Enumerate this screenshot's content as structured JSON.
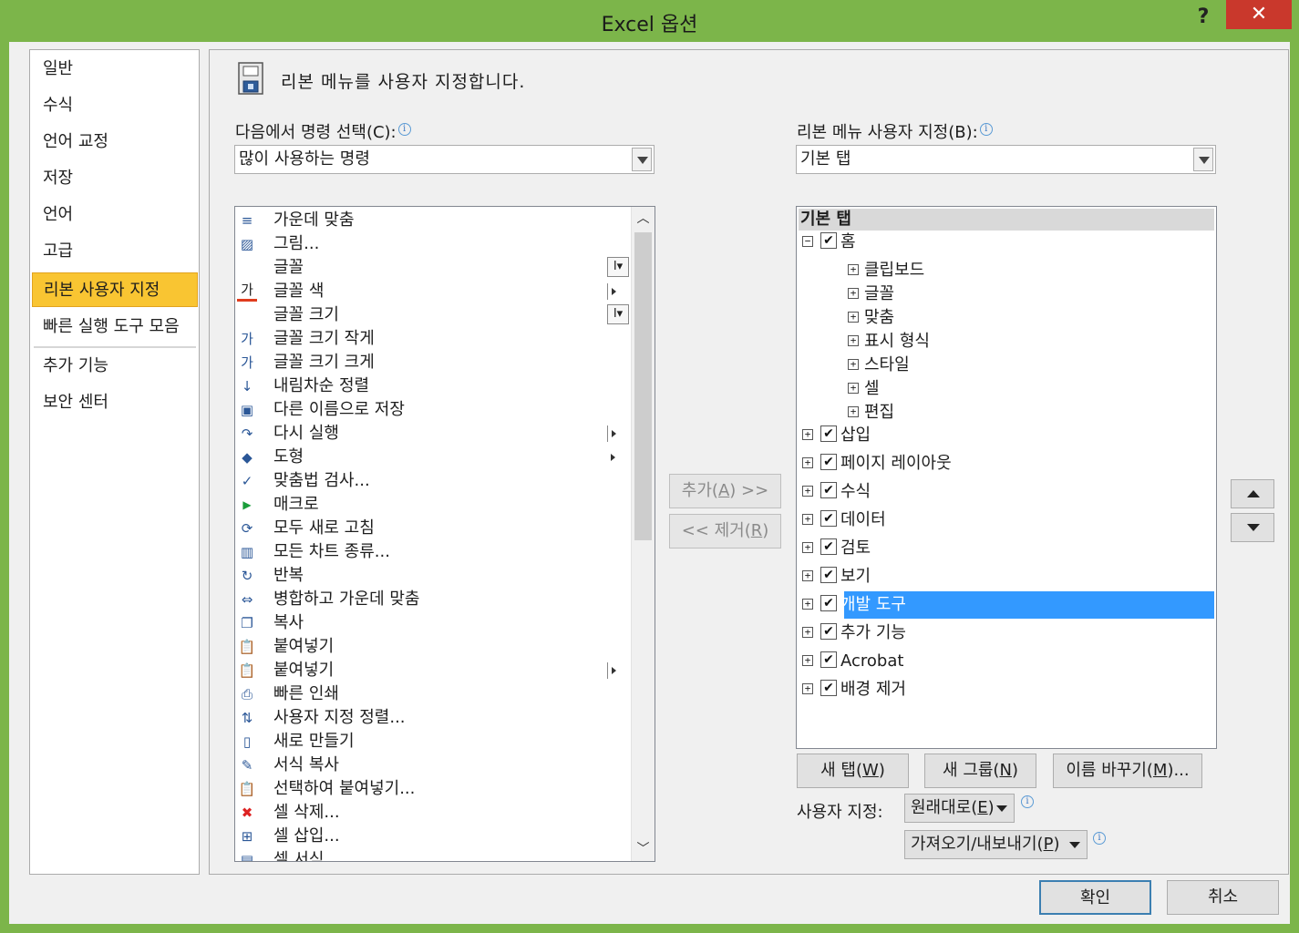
{
  "window": {
    "title": "Excel 옵션",
    "help": "?",
    "close": "✕"
  },
  "nav": {
    "items": [
      {
        "label": "일반",
        "active": false
      },
      {
        "label": "수식",
        "active": false
      },
      {
        "label": "언어 교정",
        "active": false
      },
      {
        "label": "저장",
        "active": false
      },
      {
        "label": "언어",
        "active": false
      },
      {
        "label": "고급",
        "active": false
      },
      {
        "label": "리본 사용자 지정",
        "active": true
      },
      {
        "label": "빠른 실행 도구 모음",
        "active": false
      },
      {
        "label": "추가 기능",
        "active": false
      },
      {
        "label": "보안 센터",
        "active": false
      }
    ]
  },
  "main": {
    "heading": "리본 메뉴를 사용자 지정합니다.",
    "left_label": "다음에서 명령 선택",
    "left_label_key": "(C):",
    "left_combo": "많이 사용하는 명령",
    "right_label": "리본 메뉴 사용자 지정",
    "right_label_key": "(B):",
    "right_combo": "기본 탭",
    "info_glyph": "i"
  },
  "commands": [
    {
      "label": "가운데 맞춤",
      "icon": "align-center-icon",
      "glyph": "≡",
      "extra": ""
    },
    {
      "label": "그림...",
      "icon": "picture-icon",
      "glyph": "▨",
      "extra": ""
    },
    {
      "label": "글꼴",
      "icon": "",
      "glyph": "",
      "extra": "font-control"
    },
    {
      "label": "글꼴 색",
      "icon": "font-color-icon",
      "glyph": "가",
      "extra": "submenu"
    },
    {
      "label": "글꼴 크기",
      "icon": "",
      "glyph": "",
      "extra": "font-control"
    },
    {
      "label": "글꼴 크기 작게",
      "icon": "shrink-font-icon",
      "glyph": "가",
      "extra": ""
    },
    {
      "label": "글꼴 크기 크게",
      "icon": "grow-font-icon",
      "glyph": "가",
      "extra": ""
    },
    {
      "label": "내림차순 정렬",
      "icon": "sort-descending-icon",
      "glyph": "↓",
      "extra": ""
    },
    {
      "label": "다른 이름으로 저장",
      "icon": "save-as-icon",
      "glyph": "▣",
      "extra": ""
    },
    {
      "label": "다시 실행",
      "icon": "redo-icon",
      "glyph": "↷",
      "extra": "submenu"
    },
    {
      "label": "도형",
      "icon": "shapes-icon",
      "glyph": "◆",
      "extra": "submenu-noline"
    },
    {
      "label": "맞춤법 검사...",
      "icon": "spelling-icon",
      "glyph": "✓",
      "extra": ""
    },
    {
      "label": "매크로",
      "icon": "macro-icon",
      "glyph": "▶",
      "extra": ""
    },
    {
      "label": "모두 새로 고침",
      "icon": "refresh-all-icon",
      "glyph": "⟳",
      "extra": ""
    },
    {
      "label": "모든 차트 종류...",
      "icon": "chart-icon",
      "glyph": "▥",
      "extra": ""
    },
    {
      "label": "반복",
      "icon": "repeat-icon",
      "glyph": "↻",
      "extra": ""
    },
    {
      "label": "병합하고 가운데 맞춤",
      "icon": "merge-center-icon",
      "glyph": "⇔",
      "extra": ""
    },
    {
      "label": "복사",
      "icon": "copy-icon",
      "glyph": "❐",
      "extra": ""
    },
    {
      "label": "붙여넣기",
      "icon": "paste-icon",
      "glyph": "📋",
      "extra": ""
    },
    {
      "label": "붙여넣기",
      "icon": "paste-icon",
      "glyph": "📋",
      "extra": "submenu"
    },
    {
      "label": "빠른 인쇄",
      "icon": "quick-print-icon",
      "glyph": "⎙",
      "extra": ""
    },
    {
      "label": "사용자 지정 정렬...",
      "icon": "custom-sort-icon",
      "glyph": "⇅",
      "extra": ""
    },
    {
      "label": "새로 만들기",
      "icon": "new-file-icon",
      "glyph": "▯",
      "extra": ""
    },
    {
      "label": "서식 복사",
      "icon": "format-painter-icon",
      "glyph": "✎",
      "extra": ""
    },
    {
      "label": "선택하여 붙여넣기...",
      "icon": "paste-special-icon",
      "glyph": "📋",
      "extra": ""
    },
    {
      "label": "셀 삭제...",
      "icon": "delete-cells-icon",
      "glyph": "✖",
      "extra": ""
    },
    {
      "label": "셀 삽입...",
      "icon": "insert-cells-icon",
      "glyph": "⊞",
      "extra": ""
    },
    {
      "label": "셀 서식...",
      "icon": "format-cells-icon",
      "glyph": "▤",
      "extra": ""
    }
  ],
  "buttons": {
    "add": "추가(A) >>",
    "add_pre": "추가(",
    "add_key": "A",
    "add_post": ") >>",
    "remove_pre": "<< 제거(",
    "remove_key": "R",
    "remove_post": ")",
    "new_tab_pre": "새 탭(",
    "new_tab_key": "W",
    "new_tab_post": ")",
    "new_group_pre": "새 그룹(",
    "new_group_key": "N",
    "new_group_post": ")",
    "rename_pre": "이름 바꾸기(",
    "rename_key": "M",
    "rename_post": ")...",
    "ok": "확인",
    "cancel": "취소"
  },
  "tree": {
    "header": "기본 탭",
    "home": {
      "label": "홈",
      "checked": true,
      "expander": "−"
    },
    "home_groups": [
      "클립보드",
      "글꼴",
      "맞춤",
      "표시 형식",
      "스타일",
      "셀",
      "편집"
    ],
    "tabs": [
      {
        "label": "삽입",
        "checked": true,
        "selected": false
      },
      {
        "label": "페이지 레이아웃",
        "checked": true,
        "selected": false
      },
      {
        "label": "수식",
        "checked": true,
        "selected": false
      },
      {
        "label": "데이터",
        "checked": true,
        "selected": false
      },
      {
        "label": "검토",
        "checked": true,
        "selected": false
      },
      {
        "label": "보기",
        "checked": true,
        "selected": false
      },
      {
        "label": "개발 도구",
        "checked": true,
        "selected": true
      },
      {
        "label": "추가 기능",
        "checked": true,
        "selected": false
      },
      {
        "label": "Acrobat",
        "checked": true,
        "selected": false
      },
      {
        "label": "배경 제거",
        "checked": true,
        "selected": false
      }
    ],
    "plus": "+",
    "check": "✔"
  },
  "customize": {
    "label": "사용자 지정:",
    "reset_pre": "원래대로(",
    "reset_key": "E",
    "reset_post": ")",
    "import_pre": "가져오기/내보내기(",
    "import_key": "P",
    "import_post": ")"
  },
  "colors": {
    "title_bar": "#7cb54a",
    "close_button": "#c9382c",
    "nav_active": "#f9c532",
    "selection": "#3399ff"
  }
}
